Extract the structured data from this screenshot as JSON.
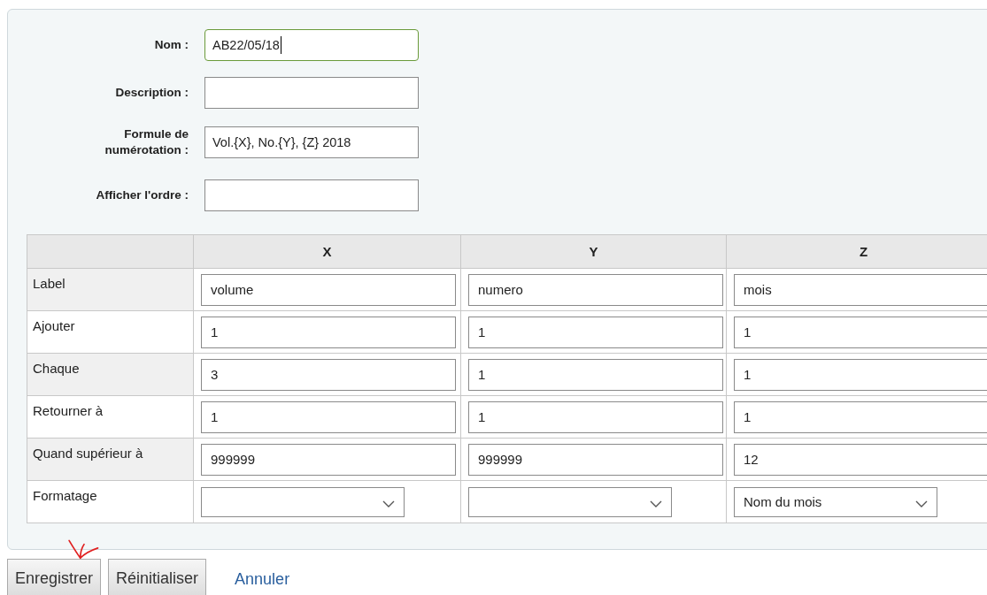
{
  "form": {
    "fields": [
      {
        "label": "Nom :",
        "value": "AB22/05/18",
        "focused": true
      },
      {
        "label": "Description :",
        "focused": false
      },
      {
        "label": "Formule de numérotation :",
        "value": "Vol.{X}, No.{Y}, {Z} 2018",
        "focused": false
      },
      {
        "label": "Afficher l'ordre :",
        "focused": false
      }
    ]
  },
  "table": {
    "columns": [
      "X",
      "Y",
      "Z"
    ],
    "rows": [
      {
        "label": "Label",
        "cells": [
          {
            "kind": "input",
            "value": "volume"
          },
          {
            "kind": "input",
            "value": "numero"
          },
          {
            "kind": "input",
            "value": "mois"
          }
        ]
      },
      {
        "label": "Ajouter",
        "cells": [
          {
            "kind": "input",
            "value": "1"
          },
          {
            "kind": "input",
            "value": "1"
          },
          {
            "kind": "input",
            "value": "1"
          }
        ]
      },
      {
        "label": "Chaque",
        "cells": [
          {
            "kind": "input",
            "value": "3"
          },
          {
            "kind": "input",
            "value": "1"
          },
          {
            "kind": "input",
            "value": "1"
          }
        ]
      },
      {
        "label": "Retourner à",
        "cells": [
          {
            "kind": "input",
            "value": "1"
          },
          {
            "kind": "input",
            "value": "1"
          },
          {
            "kind": "input",
            "value": "1"
          }
        ]
      },
      {
        "label": "Quand supérieur à",
        "cells": [
          {
            "kind": "input",
            "value": "999999"
          },
          {
            "kind": "input",
            "value": "999999"
          },
          {
            "kind": "input",
            "value": "12"
          }
        ]
      },
      {
        "label": "Formatage",
        "cells": [
          {
            "kind": "select"
          },
          {
            "kind": "select"
          },
          {
            "kind": "select",
            "value": "Nom du mois"
          }
        ]
      }
    ]
  },
  "buttons": [
    {
      "label": "Enregistrer",
      "kind": "button"
    },
    {
      "label": "Réinitialiser",
      "kind": "button"
    },
    {
      "label": "Annuler",
      "kind": "link"
    }
  ]
}
